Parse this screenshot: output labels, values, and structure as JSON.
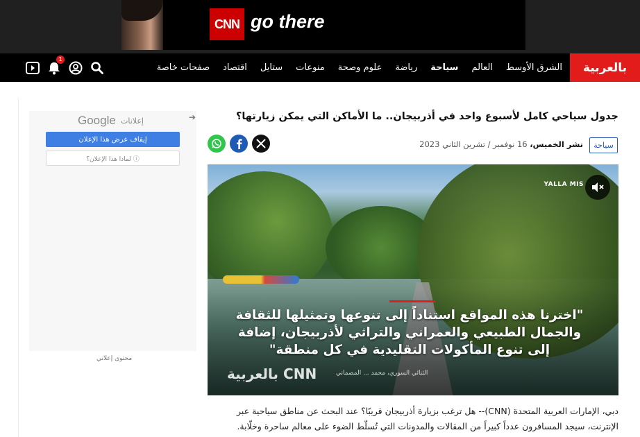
{
  "top_ad": {
    "brand": "CNN",
    "tagline": "go there"
  },
  "nav": {
    "logo": "بالعربية",
    "items": [
      "الشرق الأوسط",
      "العالم",
      "سياحة",
      "رياضة",
      "علوم وصحة",
      "منوعات",
      "ستايل",
      "اقتصاد",
      "صفحات خاصة"
    ],
    "active_index": 2,
    "notifications_count": "1",
    "icons": [
      "search-icon",
      "user-icon",
      "bell-icon",
      "play-icon"
    ]
  },
  "sidebar_ad": {
    "google_label": "Google",
    "ads_label": "إعلانات",
    "stop_button": "إيقاف عرض هذا الإعلان",
    "why_button": "لماذا هذا الإعلان؟ ⓘ",
    "sponsored_label": "محتوى إعلاني"
  },
  "article": {
    "title": "جدول سياحي كامل لأسبوع واحد في أذربيجان.. ما الأماكن التي يمكن زيارتها؟",
    "category": "سياحة",
    "published_prefix": "نشر الخميس،",
    "published_date": "16 نوفمبر / تشرين الثاني 2023",
    "share": [
      "x-icon",
      "facebook-icon",
      "whatsapp-icon"
    ],
    "video": {
      "channel": "YALLA MIS",
      "caption": "\"اخترنا هذه المواقع استناداً إلى تنوعها وتمثيلها للثقافة والجمال الطبيعي والعمراني والتراثي لأذربيجان، إضافة إلى تنوع المأكولات التقليدية في كل منطقة\"",
      "credit": "الثنائي السوري، محمد ... المصماني",
      "watermark": "بالعربية CNN"
    },
    "body": "دبي، الإمارات العربية المتحدة (CNN)-- هل ترغب بزيارة أذربيجان قريبًا؟ عند البحث عن مناطق سياحية عبر الإنترنت، سيجد المسافرون عدداً كبيراً من المقالات والمدونات التي تُسلّط الضوء على معالم ساحرة وخلّابة."
  }
}
